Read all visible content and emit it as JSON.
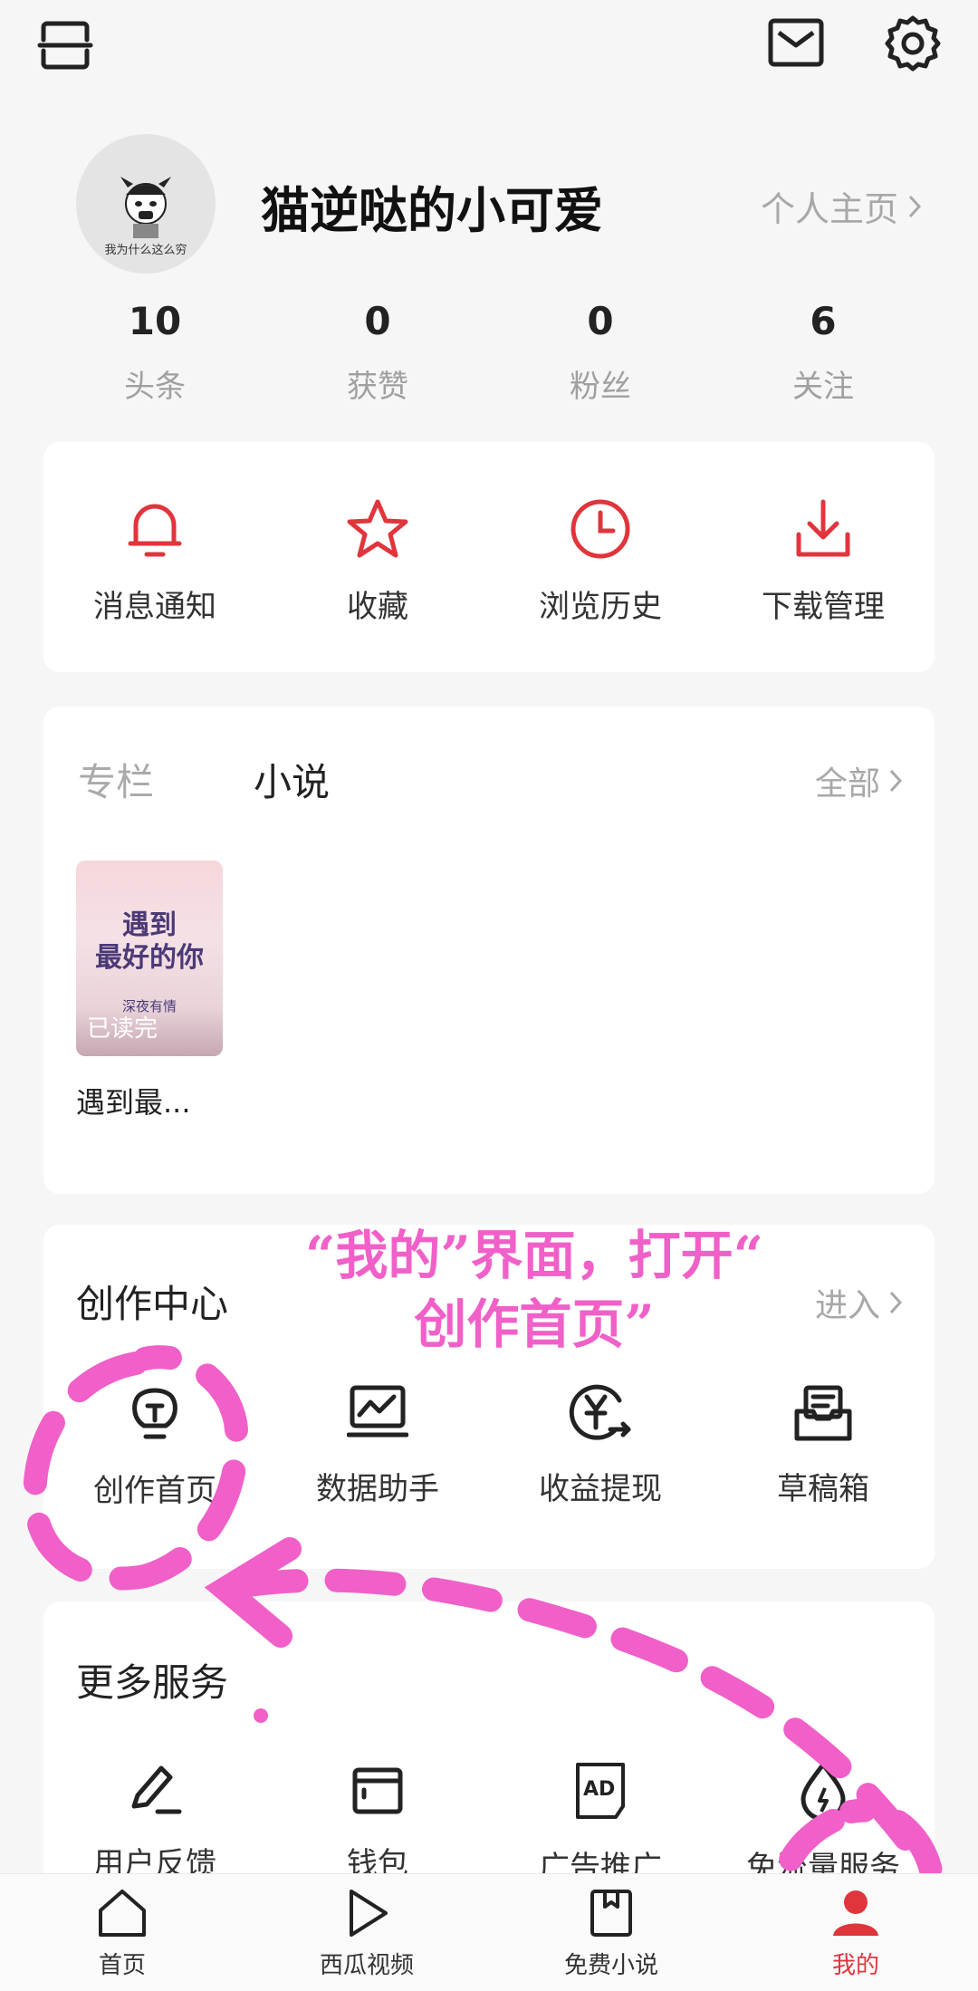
{
  "header": {
    "scan_icon": "scan-icon",
    "mail_icon": "mail-icon",
    "settings_icon": "gear-icon"
  },
  "profile": {
    "avatar_caption": "我为什么这么穷",
    "username": "猫逆哒的小可爱",
    "homepage_label": "个人主页"
  },
  "stats": [
    {
      "value": "10",
      "label": "头条"
    },
    {
      "value": "0",
      "label": "获赞"
    },
    {
      "value": "0",
      "label": "粉丝"
    },
    {
      "value": "6",
      "label": "关注"
    }
  ],
  "quick_actions": [
    {
      "label": "消息通知",
      "icon": "bell-icon"
    },
    {
      "label": "收藏",
      "icon": "star-icon"
    },
    {
      "label": "浏览历史",
      "icon": "clock-icon"
    },
    {
      "label": "下载管理",
      "icon": "download-icon"
    }
  ],
  "shelf": {
    "tab_column": "专栏",
    "tab_novel": "小说",
    "see_all": "全部",
    "book": {
      "cover_title_line1": "遇到",
      "cover_title_line2": "最好的你",
      "cover_subtitle": "深夜有情",
      "status": "已读完",
      "name": "遇到最..."
    }
  },
  "creator": {
    "title": "创作中心",
    "enter_label": "进入",
    "items": [
      {
        "label": "创作首页",
        "icon": "lightbulb-icon"
      },
      {
        "label": "数据助手",
        "icon": "chart-monitor-icon"
      },
      {
        "label": "收益提现",
        "icon": "yen-withdraw-icon"
      },
      {
        "label": "草稿箱",
        "icon": "draft-box-icon"
      }
    ]
  },
  "services": {
    "title": "更多服务",
    "items": [
      {
        "label": "用户反馈",
        "icon": "pen-feedback-icon"
      },
      {
        "label": "钱包",
        "icon": "wallet-icon"
      },
      {
        "label": "广告推广",
        "icon": "ad-icon"
      },
      {
        "label": "免流量服务",
        "icon": "data-drop-icon"
      }
    ]
  },
  "annotation": {
    "line1": "“我的”界面，打开“",
    "line2": "创作首页”",
    "color": "#f060c8"
  },
  "tabbar": [
    {
      "label": "首页",
      "icon": "home-icon"
    },
    {
      "label": "西瓜视频",
      "icon": "play-icon"
    },
    {
      "label": "免费小说",
      "icon": "book-icon"
    },
    {
      "label": "我的",
      "icon": "person-icon",
      "active": true
    }
  ],
  "colors": {
    "accent": "#e0353c",
    "annotation": "#f060c8"
  }
}
